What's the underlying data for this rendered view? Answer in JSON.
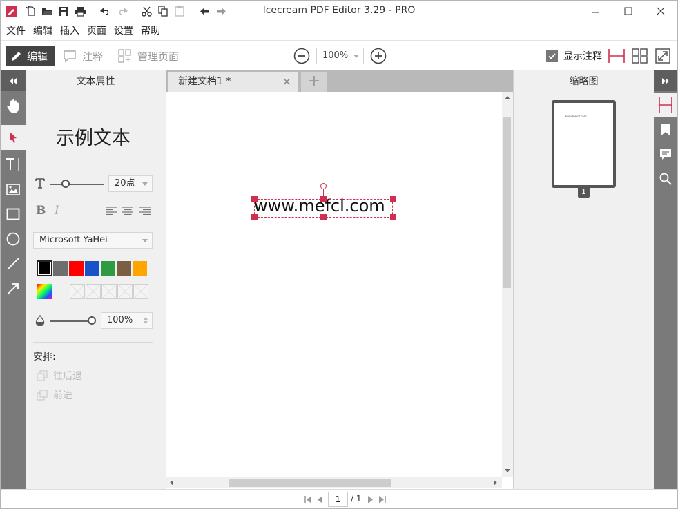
{
  "window": {
    "title": "Icecream PDF Editor 3.29 - PRO"
  },
  "menu": [
    "文件",
    "编辑",
    "插入",
    "页面",
    "设置",
    "帮助"
  ],
  "toolbar": {
    "mode_edit": "编辑",
    "mode_annotate": "注释",
    "mode_manage_pages": "管理页面",
    "zoom": "100%",
    "show_annotations": "显示注释",
    "show_annotations_checked": true
  },
  "properties_panel": {
    "title": "文本属性",
    "sample_text": "示例文本",
    "font_size": "20点",
    "font_size_slider_fraction": 0.29,
    "font_family": "Microsoft YaHei",
    "colors": [
      "#000000",
      "#6e6e6e",
      "#ff0000",
      "#1a50c8",
      "#2f9a41",
      "#7a5f45",
      "#ffa500"
    ],
    "selected_color": "#000000",
    "opacity": "100%",
    "opacity_fraction": 1.0,
    "arrange_label": "安排:",
    "send_backward": "往后退",
    "bring_forward": "前进"
  },
  "tabs": [
    {
      "label": "新建文档1 *",
      "active": true
    }
  ],
  "document": {
    "text_box": "www.mefcl.com"
  },
  "thumbnails": {
    "title": "缩略图",
    "pages": [
      {
        "number": "1",
        "text": "www.mefcl.com"
      }
    ]
  },
  "statusbar": {
    "current_page": "1",
    "total": "/ 1"
  },
  "colors": {
    "accent": "#d03050",
    "dark_button": "#444444",
    "sidebar": "#7a7a7a",
    "panel_bg": "#f0f0f0"
  }
}
